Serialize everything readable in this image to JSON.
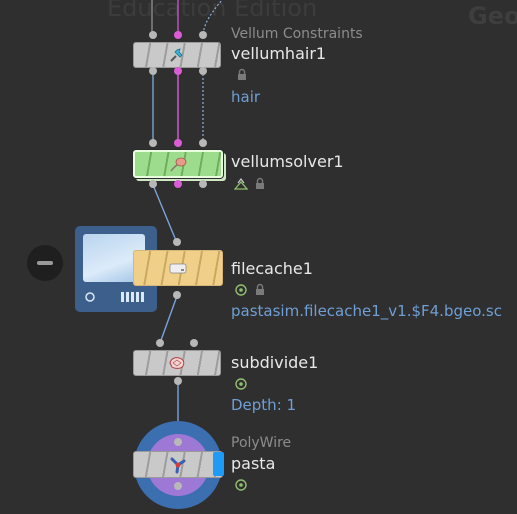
{
  "background": {
    "watermark": "Education Edition",
    "context_label": "Geo"
  },
  "colors": {
    "bg": "#2f2f2f",
    "param_blue": "#6f9fd4",
    "pink_wire": "#dc5cd8",
    "solver_green": "#9ddc8c",
    "filecache_tan": "#f0cf88",
    "display_blue": "#1e9bf5"
  },
  "nodes": {
    "vellumhair": {
      "type_label": "Vellum Constraints",
      "name": "vellumhair1",
      "param": "hair",
      "icon": "pin-icon"
    },
    "vellumsolver": {
      "name": "vellumsolver1",
      "icon": "solver-icon"
    },
    "filecache": {
      "name": "filecache1",
      "param": "pastasim.filecache1_v1.$F4.bgeo.sc",
      "icon": "disk-icon"
    },
    "subdivide": {
      "name": "subdivide1",
      "param": "Depth: 1",
      "icon": "subdivide-icon"
    },
    "pasta": {
      "type_label": "PolyWire",
      "name": "pasta",
      "icon": "polywire-icon"
    }
  }
}
